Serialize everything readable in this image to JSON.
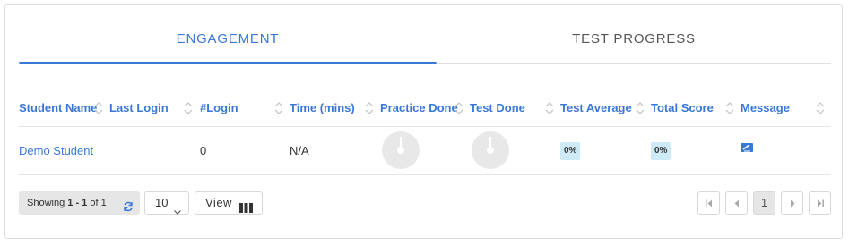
{
  "tabs": [
    {
      "label": "ENGAGEMENT",
      "active": true
    },
    {
      "label": "TEST PROGRESS",
      "active": false
    }
  ],
  "table": {
    "columns": [
      "Student Name",
      "Last Login",
      "#Login",
      "Time (mins)",
      "Practice Done",
      "Test Done",
      "Test Average",
      "Total Score",
      "Message"
    ],
    "rows": [
      {
        "student_name": "Demo Student",
        "last_login": "",
        "logins": "0",
        "time": "N/A",
        "practice_done": 0,
        "test_done": 0,
        "test_average": "0%",
        "total_score": "0%",
        "message_icon": "message-edit-icon"
      }
    ]
  },
  "footer": {
    "showing_prefix": "Showing ",
    "showing_range": "1 - 1",
    "showing_suffix": " of 1",
    "page_size": "10",
    "view_label": "View",
    "current_page": "1"
  },
  "icons": {
    "sort": "sort-arrows-icon",
    "refresh": "refresh-icon",
    "columns": "columns-icon",
    "first": "first-page-icon",
    "prev": "prev-page-icon",
    "next": "next-page-icon",
    "last": "last-page-icon"
  },
  "colors": {
    "accent": "#3a78d8",
    "badge_bg": "#cdeaf6",
    "pie": "#e8e8e8"
  }
}
